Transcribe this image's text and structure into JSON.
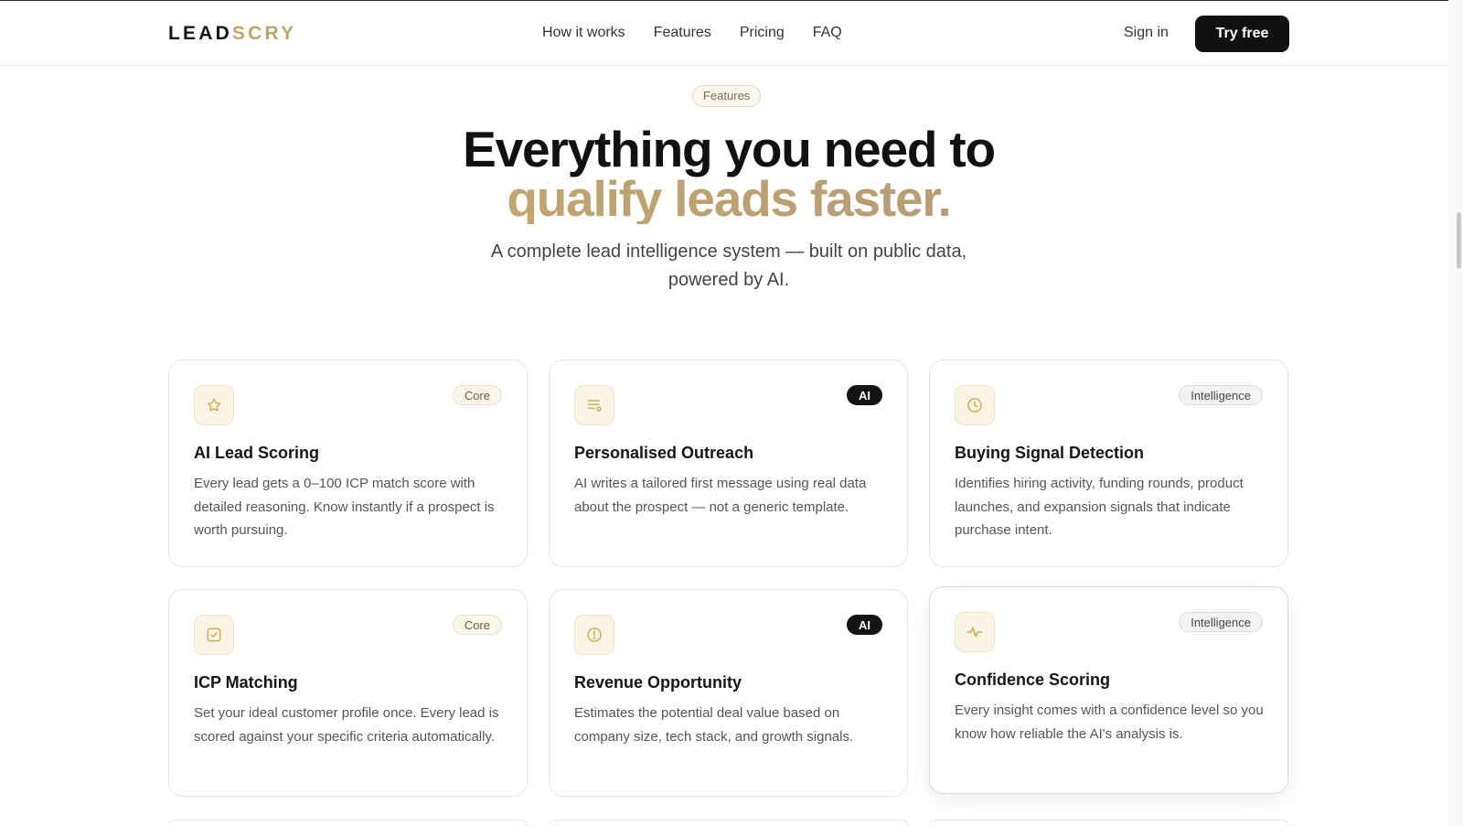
{
  "brand": {
    "part1": "LEAD",
    "part2": "SCRY"
  },
  "nav": {
    "items": [
      "How it works",
      "Features",
      "Pricing",
      "FAQ"
    ]
  },
  "auth": {
    "signin": "Sign in",
    "cta": "Try free"
  },
  "section": {
    "pill": "Features",
    "heading_line1": "Everything you need to",
    "heading_line2": "qualify leads faster.",
    "sub_line1": "A complete lead intelligence system — built on public data,",
    "sub_line2": "powered by AI."
  },
  "cards": [
    {
      "title": "AI Lead Scoring",
      "badge": "Core",
      "icon": "star-icon",
      "desc": "Every lead gets a 0–100 ICP match score with detailed reasoning. Know instantly if a prospect is worth pursuing."
    },
    {
      "title": "Personalised Outreach",
      "badge": "AI",
      "icon": "message-lines-icon",
      "desc": "AI writes a tailored first message using real data about the prospect — not a generic template."
    },
    {
      "title": "Buying Signal Detection",
      "badge": "Intelligence",
      "icon": "clock-icon",
      "desc": "Identifies hiring activity, funding rounds, product launches, and expansion signals that indicate purchase intent."
    },
    {
      "title": "ICP Matching",
      "badge": "Core",
      "icon": "checkbox-icon",
      "desc": "Set your ideal customer profile once. Every lead is scored against your specific criteria automatically."
    },
    {
      "title": "Revenue Opportunity",
      "badge": "AI",
      "icon": "alert-circle-icon",
      "desc": "Estimates the potential deal value based on company size, tech stack, and growth signals."
    },
    {
      "title": "Confidence Scoring",
      "badge": "Intelligence",
      "icon": "pulse-icon",
      "desc": "Every insight comes with a confidence level so you know how reliable the AI's analysis is."
    }
  ],
  "colors": {
    "accent": "#c2a46a",
    "accent_light": "#fcf5e6",
    "dark": "#111111"
  }
}
